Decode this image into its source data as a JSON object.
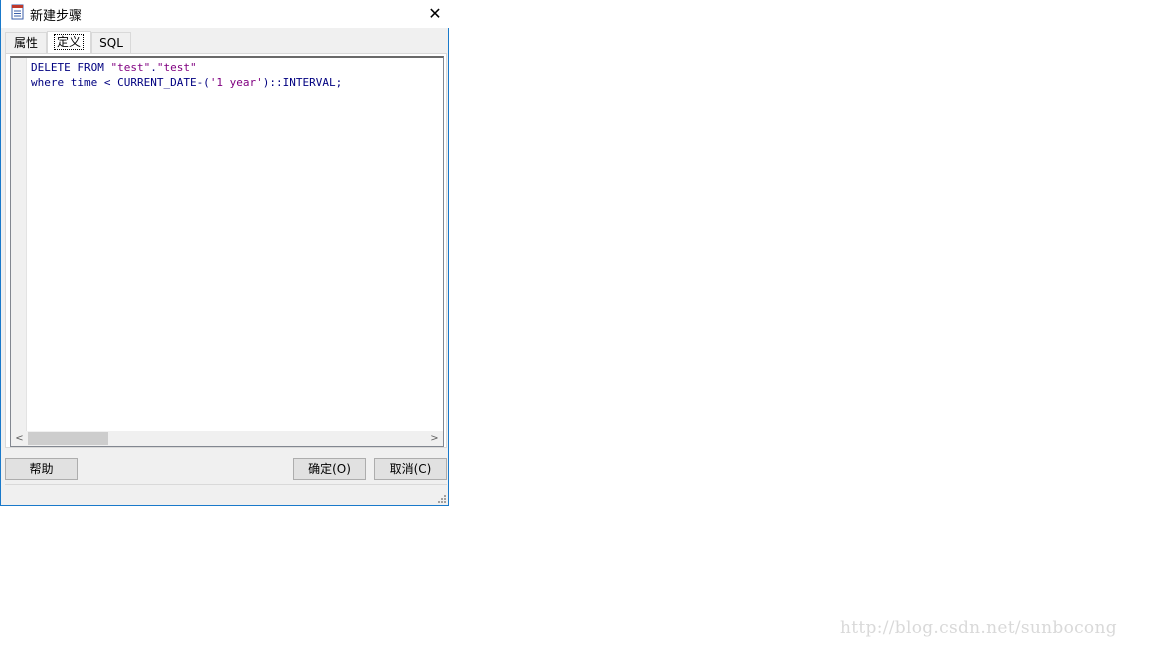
{
  "window": {
    "title": "新建步骤",
    "close_glyph": "✕",
    "icon": "document-icon"
  },
  "tabs": [
    {
      "label": "属性",
      "active": false
    },
    {
      "label": "定义",
      "active": true
    },
    {
      "label": "SQL",
      "active": false
    }
  ],
  "editor": {
    "lines": [
      {
        "parts": [
          {
            "text": "DELETE FROM ",
            "type": "keyword"
          },
          {
            "text": "\"test\"",
            "type": "string"
          },
          {
            "text": ".",
            "type": "keyword"
          },
          {
            "text": "\"test\"",
            "type": "string"
          }
        ]
      },
      {
        "parts": [
          {
            "text": "where time < CURRENT_DATE-(",
            "type": "keyword"
          },
          {
            "text": "'1 year'",
            "type": "string"
          },
          {
            "text": ")::INTERVAL;",
            "type": "keyword"
          }
        ]
      }
    ],
    "scroll_left_glyph": "<",
    "scroll_right_glyph": ">"
  },
  "buttons": {
    "help": "帮助",
    "ok": "确定(O)",
    "cancel": "取消(C)"
  },
  "watermark": "http://blog.csdn.net/sunbocong",
  "colors": {
    "keyword": "#000080",
    "string": "#800080",
    "border_accent": "#1979ca"
  }
}
